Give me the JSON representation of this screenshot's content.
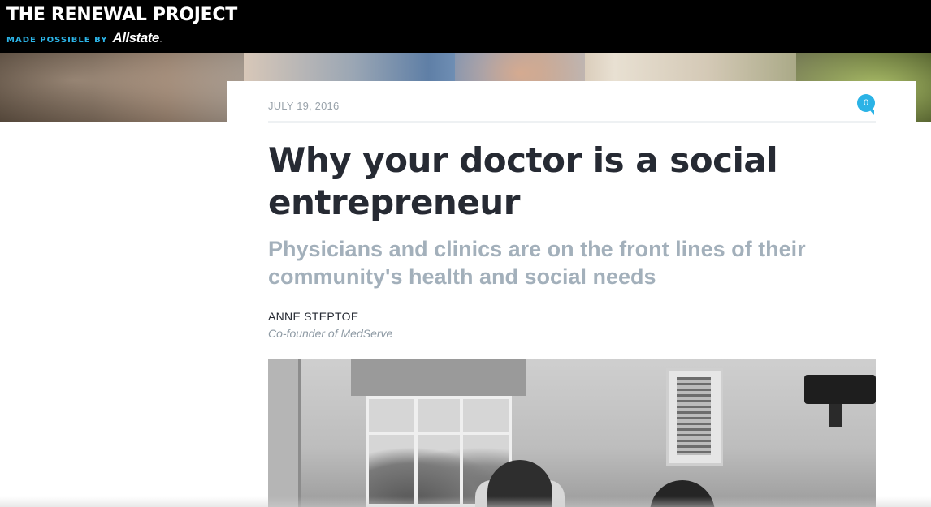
{
  "header": {
    "site_title": "THE RENEWAL PROJECT",
    "made_possible_by": "MADE POSSIBLE BY",
    "sponsor_logo": "Allstate",
    "sponsor_logo_mark": "."
  },
  "article": {
    "date": "JULY 19, 2016",
    "comment_count": "0",
    "headline": "Why your doctor is a social entrepreneur",
    "subheadline": "Physicians and clinics are on the front lines of their community's health and social needs",
    "author_name": "ANNE STEPTOE",
    "author_role": "Co-founder of MedServe"
  },
  "colors": {
    "accent": "#2bb3e6",
    "headline": "#262a33",
    "subheadline": "#a3b0bb",
    "topbar": "#000000"
  },
  "icons": {
    "comment": "comment-bubble-icon"
  }
}
